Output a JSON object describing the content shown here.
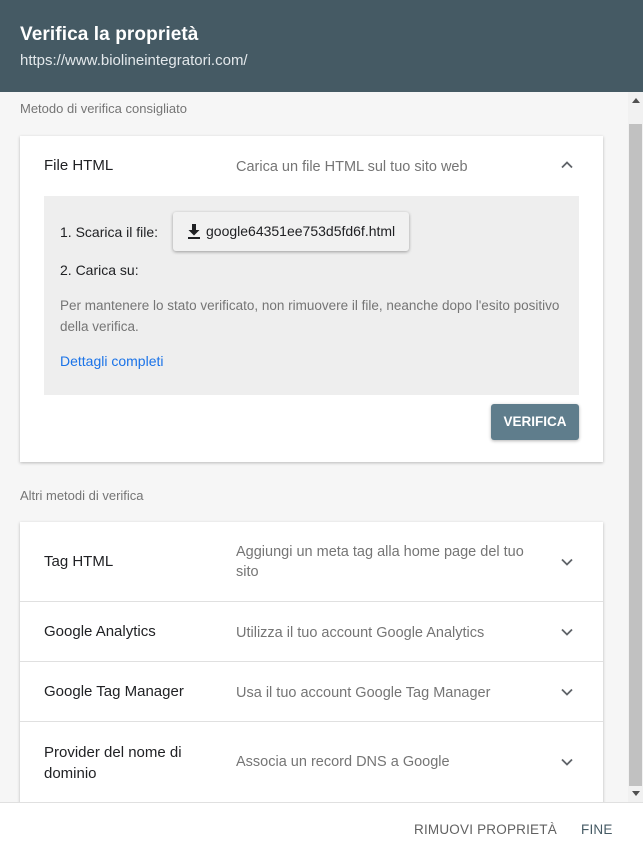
{
  "header": {
    "title": "Verifica la proprietà",
    "subtitle": "https://www.biolineintegratori.com/"
  },
  "recommended": {
    "section_label": "Metodo di verifica consigliato",
    "method": {
      "title": "File HTML",
      "description": "Carica un file HTML sul tuo sito web",
      "expanded": true,
      "step1_label": "1. Scarica il file:",
      "download_file": "google64351ee753d5fd6f.html",
      "step2_label": "2. Carica su:",
      "note": "Per mantenere lo stato verificato, non rimuovere il file, neanche dopo l'esito positivo della verifica.",
      "details_link": "Dettagli completi",
      "verify_button": "VERIFICA"
    }
  },
  "other": {
    "section_label": "Altri metodi di verifica",
    "methods": [
      {
        "title": "Tag HTML",
        "description": "Aggiungi un meta tag alla home page del tuo sito"
      },
      {
        "title": "Google Analytics",
        "description": "Utilizza il tuo account Google Analytics"
      },
      {
        "title": "Google Tag Manager",
        "description": "Usa il tuo account Google Tag Manager"
      },
      {
        "title": "Provider del nome di dominio",
        "description": "Associa un record DNS a Google"
      }
    ]
  },
  "footer": {
    "remove_button": "RIMUOVI PROPRIETÀ",
    "done_button": "FINE"
  },
  "colors": {
    "header_bg": "#455a64",
    "verify_button_bg": "#5f7d8c",
    "link": "#1a73e8"
  },
  "icons": {
    "expanded": "chevron-up-icon",
    "collapsed": "chevron-down-icon",
    "download": "download-icon"
  }
}
